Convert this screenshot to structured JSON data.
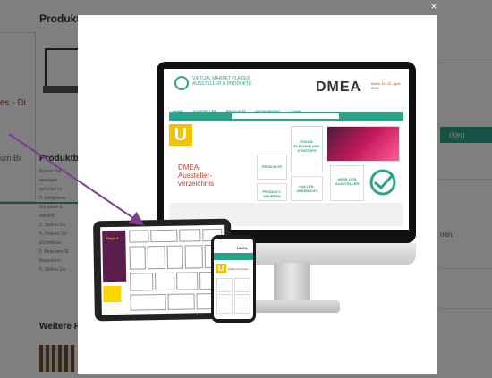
{
  "page": {
    "title": "Produkt",
    "side_link": "es - Di",
    "side_link2": "um Br",
    "description_heading": "Produktbe",
    "description_lines": [
      "Nutzen Sie",
      "anzeigen",
      "gefunden z",
      "2. Integrieren",
      "Sie daher a",
      "werden.",
      "3. Stellen Sie",
      "4. Ordnen Sie",
      "Schnellnav",
      "5. Beachten Si",
      "Besuchern",
      "6. Stellen Sie"
    ],
    "more_heading": "Weitere P",
    "right_button": "rken",
    "right_text": "nen"
  },
  "modal": {
    "close_glyph": "×",
    "website": {
      "logo_text": "VIRTUAL MARKET PLACE® AUSSTELLER & PRODUKTE",
      "brand": "DMEA",
      "date": "Berlin 11.-15. April 2021",
      "nav": [
        "HOME",
        "AUSSTELLER",
        "PRODUKTE",
        "NETWORKING",
        "LOGIN"
      ],
      "hero_title": "DMEA-Aussteller-verzeichnis",
      "tiles": [
        "PRODUKTE",
        "FOKUS-FLÄCHEN UND STARTUPS",
        "PRODUKT-GRUPPEN",
        "HALLEN-ÜBERSICHT",
        "NEUE DER AUSSTELLER"
      ]
    },
    "tablet": {
      "label": "Stage 4"
    },
    "phone": {
      "brand": "DMEA",
      "title": "DMEA-Aussteller"
    }
  },
  "colors": {
    "accent": "#2aa38b",
    "brand_red": "#c0392b",
    "yellow": "#f2c300",
    "arrow": "#7b3f8c"
  }
}
